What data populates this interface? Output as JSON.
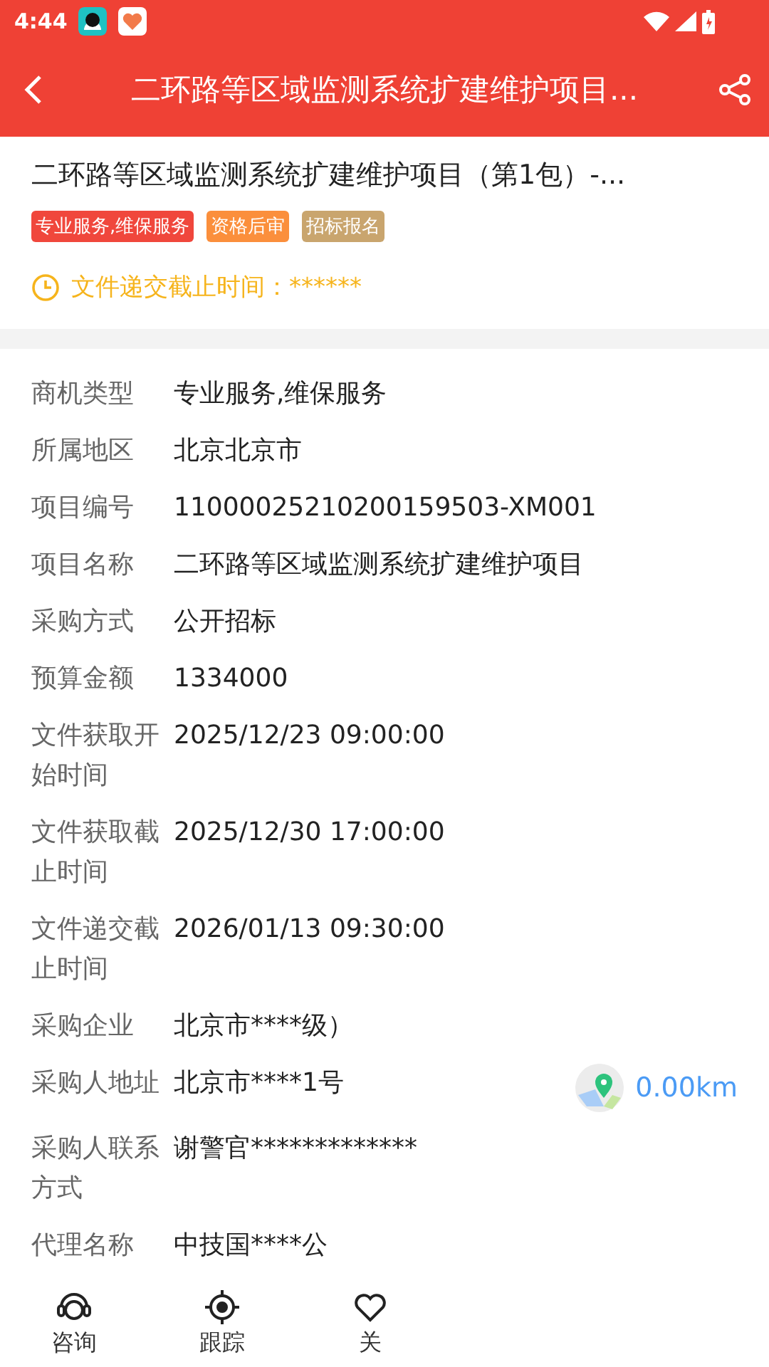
{
  "status_bar": {
    "time": "4:44"
  },
  "app_bar": {
    "title": "二环路等区域监测系统扩建维护项目..."
  },
  "header": {
    "title": "二环路等区域监测系统扩建维护项目（第1包）-...",
    "tags": [
      {
        "label": "专业服务,维保服务",
        "color": "#f0473c"
      },
      {
        "label": "资格后审",
        "color": "#fb8f3c"
      },
      {
        "label": "招标报名",
        "color": "#c9a56e"
      }
    ],
    "deadline": "文件递交截止时间：******"
  },
  "details": [
    {
      "label": "商机类型",
      "value": "专业服务,维保服务"
    },
    {
      "label": "所属地区",
      "value": "北京北京市"
    },
    {
      "label": "项目编号",
      "value": "11000025210200159503-XM001"
    },
    {
      "label": "项目名称",
      "value": "二环路等区域监测系统扩建维护项目"
    },
    {
      "label": "采购方式",
      "value": "公开招标"
    },
    {
      "label": "预算金额",
      "value": "1334000"
    },
    {
      "label": "文件获取开始时间",
      "value": "2025/12/23 09:00:00"
    },
    {
      "label": "文件获取截止时间",
      "value": "2025/12/30 17:00:00"
    },
    {
      "label": "文件递交截止时间",
      "value": "2026/01/13 09:30:00"
    },
    {
      "label": "采购企业",
      "value": "北京市****级）"
    },
    {
      "label": "采购人地址",
      "value": "北京市****1号",
      "distance": "0.00km"
    },
    {
      "label": "采购人联系方式",
      "value": "谢警官*************"
    },
    {
      "label": "代理名称",
      "value": "中技国****公"
    }
  ],
  "bottom_nav": [
    {
      "label": "咨询",
      "kind": "headset"
    },
    {
      "label": "跟踪",
      "kind": "target"
    },
    {
      "label": "关",
      "kind": "heart"
    }
  ]
}
